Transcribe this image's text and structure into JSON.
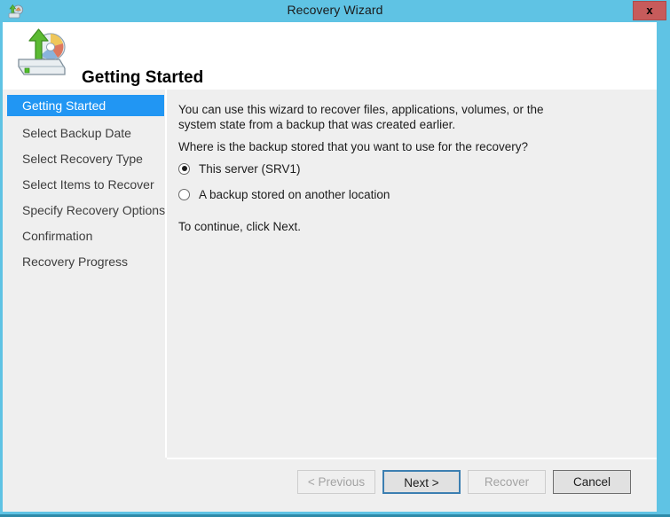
{
  "window": {
    "title": "Recovery Wizard",
    "icon": "recovery-disk-icon",
    "close_label": "x",
    "chrome_color": "#5fc3e4",
    "close_color": "#c75b5b"
  },
  "header": {
    "icon": "recovery-drive-arrow-icon",
    "title": "Getting Started"
  },
  "sidebar": {
    "active_index": 0,
    "accent_color": "#2196f3",
    "items": [
      {
        "label": "Getting Started"
      },
      {
        "label": "Select Backup Date"
      },
      {
        "label": "Select Recovery Type"
      },
      {
        "label": "Select Items to Recover"
      },
      {
        "label": "Specify Recovery Options"
      },
      {
        "label": "Confirmation"
      },
      {
        "label": "Recovery Progress"
      }
    ]
  },
  "content": {
    "intro": "You can use this wizard to recover files, applications, volumes, or the system state from a backup that was created earlier.",
    "question": "Where is the backup stored that you want to use for the recovery?",
    "options": [
      {
        "label": "This server (SRV1)",
        "checked": true
      },
      {
        "label": "A backup stored on another location",
        "checked": false
      }
    ],
    "continue_text": "To continue, click Next."
  },
  "footer": {
    "buttons": [
      {
        "label": "< Previous",
        "state": "disabled"
      },
      {
        "label": "Next >",
        "state": "default"
      },
      {
        "label": "Recover",
        "state": "disabled"
      },
      {
        "label": "Cancel",
        "state": "strong"
      }
    ]
  }
}
